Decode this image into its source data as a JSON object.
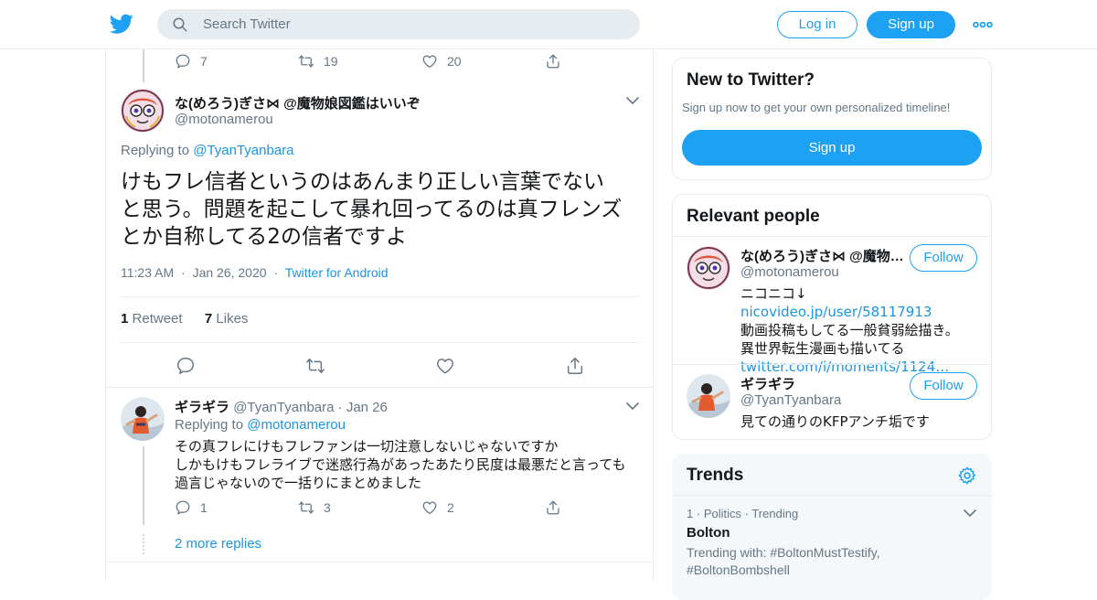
{
  "header": {
    "search_placeholder": "Search Twitter",
    "login_label": "Log in",
    "signup_label": "Sign up",
    "brand_color": "#1da1f2"
  },
  "prev_tweet": {
    "replies": "7",
    "retweets": "19",
    "likes": "20"
  },
  "main_tweet": {
    "name": "な(めろう)ぎさ⋈ @魔物娘図鑑はいいぞ",
    "handle": "@motonamerou",
    "replying_prefix": "Replying to",
    "replying_to": "@TyanTyanbara",
    "text_lines": [
      "けもフレ信者というのはあんまり正しい言葉でない",
      "と思う。問題を起こして暴れ回ってるのは真フレンズ",
      "とか自称してる2の信者ですよ"
    ],
    "time": "11:23 AM",
    "date": "Jan 26, 2020",
    "source": "Twitter for Android",
    "retweet_count": "1",
    "retweet_label": "Retweet",
    "like_count": "7",
    "like_label": "Likes"
  },
  "reply_tweet": {
    "name": "ギラギラ",
    "handle": "@TyanTyanbara",
    "date": "Jan 26",
    "replying_prefix": "Replying to",
    "replying_to": "@motonamerou",
    "text_lines": [
      "その真フレにけもフレファンは一切注意しないじゃないですか",
      "しかもけもフレライブで迷惑行為があったあたり民度は最悪だと言っても",
      "過言じゃないので一括りにまとめました"
    ],
    "replies": "1",
    "retweets": "3",
    "likes": "2",
    "more_replies": "2 more replies"
  },
  "sidebar": {
    "new_to_twitter": {
      "title": "New to Twitter?",
      "subtitle": "Sign up now to get your own personalized timeline!",
      "signup_label": "Sign up"
    },
    "relevant_people": {
      "title": "Relevant people",
      "follow_label": "Follow",
      "people": [
        {
          "name": "な(めろう)ぎさ⋈ @魔物娘図鑑はいいぞ",
          "handle": "@motonamerou",
          "bio_prefix": "ニコニコ↓ ",
          "bio_link1": "nicovideo.jp/user/58117913",
          "bio_line2": "動画投稿もしてる一般貧弱絵描き。",
          "bio_line3": "異世界転生漫画も描いてる",
          "bio_link2": "twitter.com/i/moments/1124…"
        },
        {
          "name": "ギラギラ",
          "handle": "@TyanTyanbara",
          "bio": "見ての通りのKFPアンチ垢です"
        }
      ]
    },
    "trends": {
      "title": "Trends",
      "items": [
        {
          "rank": "1",
          "category": "Politics",
          "status": "Trending",
          "name": "Bolton",
          "with_prefix": "Trending with: ",
          "with_tags": "#BoltonMustTestify, #BoltonBombshell"
        }
      ]
    }
  }
}
